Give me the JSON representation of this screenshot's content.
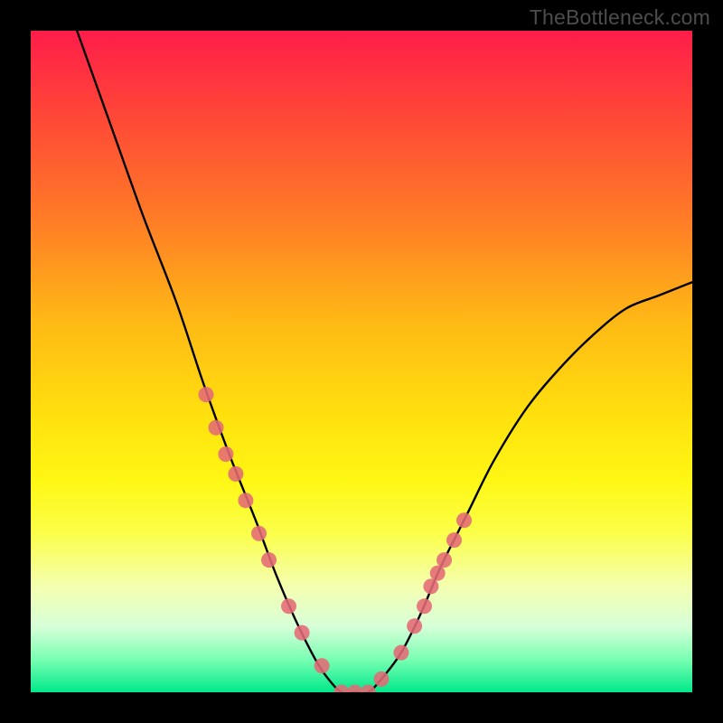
{
  "watermark": "TheBottleneck.com",
  "chart_data": {
    "type": "line",
    "title": "",
    "xlabel": "",
    "ylabel": "",
    "xlim": [
      0,
      100
    ],
    "ylim": [
      0,
      100
    ],
    "series": [
      {
        "name": "bottleneck-curve",
        "x": [
          7,
          12,
          17,
          22,
          26,
          30,
          34,
          37,
          40,
          43,
          45,
          47,
          49,
          51,
          53,
          56,
          59,
          62,
          66,
          70,
          75,
          80,
          85,
          90,
          95,
          100
        ],
        "y": [
          100,
          86,
          72,
          59,
          47,
          36,
          26,
          18,
          11,
          5,
          2,
          0,
          0,
          0,
          2,
          6,
          12,
          19,
          27,
          35,
          43,
          49,
          54,
          58,
          60,
          62
        ]
      }
    ],
    "markers": {
      "name": "highlight-points",
      "series_index": 0,
      "x": [
        26.5,
        28,
        29.5,
        31,
        32.5,
        34.5,
        36,
        39,
        41,
        44,
        47,
        49,
        51,
        53,
        56,
        58,
        59.5,
        60.5,
        61.5,
        62.5,
        64,
        65.5
      ],
      "y": [
        45,
        40,
        36,
        33,
        29,
        24,
        20,
        13,
        9,
        4,
        0,
        0,
        0,
        2,
        6,
        10,
        13,
        16,
        18,
        20,
        23,
        26
      ]
    },
    "gradient_stops": [
      {
        "pct": 0,
        "color": "#ff1d4a"
      },
      {
        "pct": 28,
        "color": "#ff7a27"
      },
      {
        "pct": 58,
        "color": "#ffe00e"
      },
      {
        "pct": 84,
        "color": "#f4ffb0"
      },
      {
        "pct": 100,
        "color": "#00e88a"
      }
    ]
  }
}
